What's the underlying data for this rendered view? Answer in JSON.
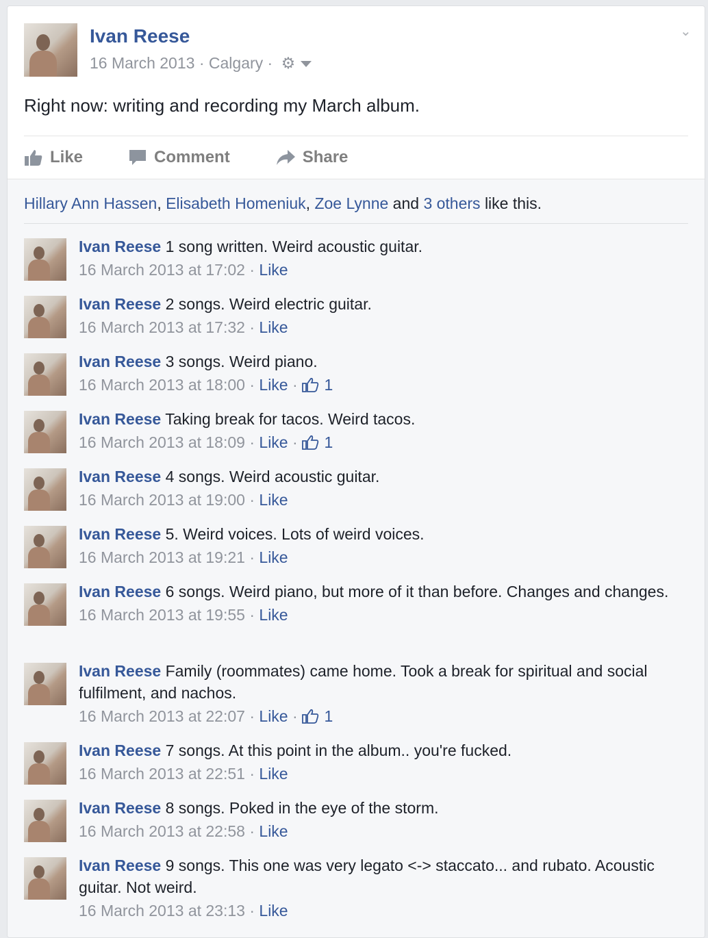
{
  "post": {
    "author": "Ivan Reese",
    "date": "16 March 2013",
    "location": "Calgary",
    "text": "Right now: writing and recording my March album."
  },
  "actions": {
    "like": "Like",
    "comment": "Comment",
    "share": "Share"
  },
  "likes": {
    "names": [
      "Hillary Ann Hassen",
      "Elisabeth Homeniuk",
      "Zoe Lynne"
    ],
    "and": "and",
    "others": "3 others",
    "suffix": "like this."
  },
  "comments": [
    {
      "author": "Ivan Reese",
      "text": "1 song written. Weird acoustic guitar.",
      "time": "16 March 2013 at 17:02",
      "like": "Like",
      "count": ""
    },
    {
      "author": "Ivan Reese",
      "text": "2 songs. Weird electric guitar.",
      "time": "16 March 2013 at 17:32",
      "like": "Like",
      "count": ""
    },
    {
      "author": "Ivan Reese",
      "text": "3 songs. Weird piano.",
      "time": "16 March 2013 at 18:00",
      "like": "Like",
      "count": "1"
    },
    {
      "author": "Ivan Reese",
      "text": "Taking break for tacos. Weird tacos.",
      "time": "16 March 2013 at 18:09",
      "like": "Like",
      "count": "1"
    },
    {
      "author": "Ivan Reese",
      "text": "4 songs. Weird acoustic guitar.",
      "time": "16 March 2013 at 19:00",
      "like": "Like",
      "count": ""
    },
    {
      "author": "Ivan Reese",
      "text": "5. Weird voices. Lots of weird voices.",
      "time": "16 March 2013 at 19:21",
      "like": "Like",
      "count": ""
    },
    {
      "author": "Ivan Reese",
      "text": "6 songs. Weird piano, but more of it than before. Changes and changes.",
      "time": "16 March 2013 at 19:55",
      "like": "Like",
      "count": ""
    },
    {
      "author": "Ivan Reese",
      "text": "Family (roommates) came home. Took a break for spiritual and social fulfilment, and nachos.",
      "time": "16 March 2013 at 22:07",
      "like": "Like",
      "count": "1"
    },
    {
      "author": "Ivan Reese",
      "text": "7 songs. At this point in the album.. you're fucked.",
      "time": "16 March 2013 at 22:51",
      "like": "Like",
      "count": ""
    },
    {
      "author": "Ivan Reese",
      "text": "8 songs. Poked in the eye of the storm.",
      "time": "16 March 2013 at 22:58",
      "like": "Like",
      "count": ""
    },
    {
      "author": "Ivan Reese",
      "text": "9 songs. This one was very legato <-> staccato... and rubato. Acoustic guitar. Not weird.",
      "time": "16 March 2013 at 23:13",
      "like": "Like",
      "count": ""
    }
  ]
}
